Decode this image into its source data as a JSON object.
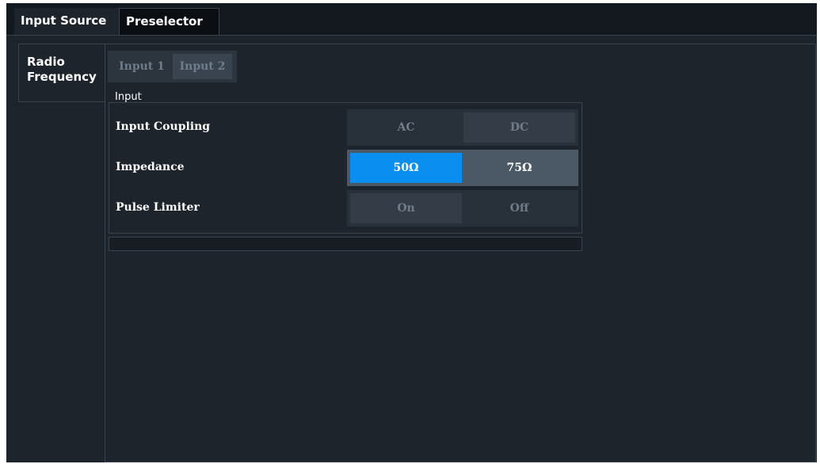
{
  "tabs": {
    "input_source": "Input Source",
    "preselector": "Preselector"
  },
  "side_tab": {
    "line1": "Radio",
    "line2": "Frequency"
  },
  "input_selector": {
    "input1": "Input 1",
    "input2": "Input 2",
    "selected": "Input 2"
  },
  "group": {
    "title": "Input",
    "rows": [
      {
        "label": "Input Coupling",
        "options": [
          "AC",
          "DC"
        ],
        "selected": "DC",
        "enabled": false
      },
      {
        "label": "Impedance",
        "options": [
          "50Ω",
          "75Ω"
        ],
        "selected": "50Ω",
        "enabled": true
      },
      {
        "label": "Pulse Limiter",
        "options": [
          "On",
          "Off"
        ],
        "selected": "On",
        "enabled": false
      }
    ]
  },
  "colors": {
    "background": "#1e242c",
    "accent": "#0a8ff0",
    "border": "#3a4450"
  }
}
